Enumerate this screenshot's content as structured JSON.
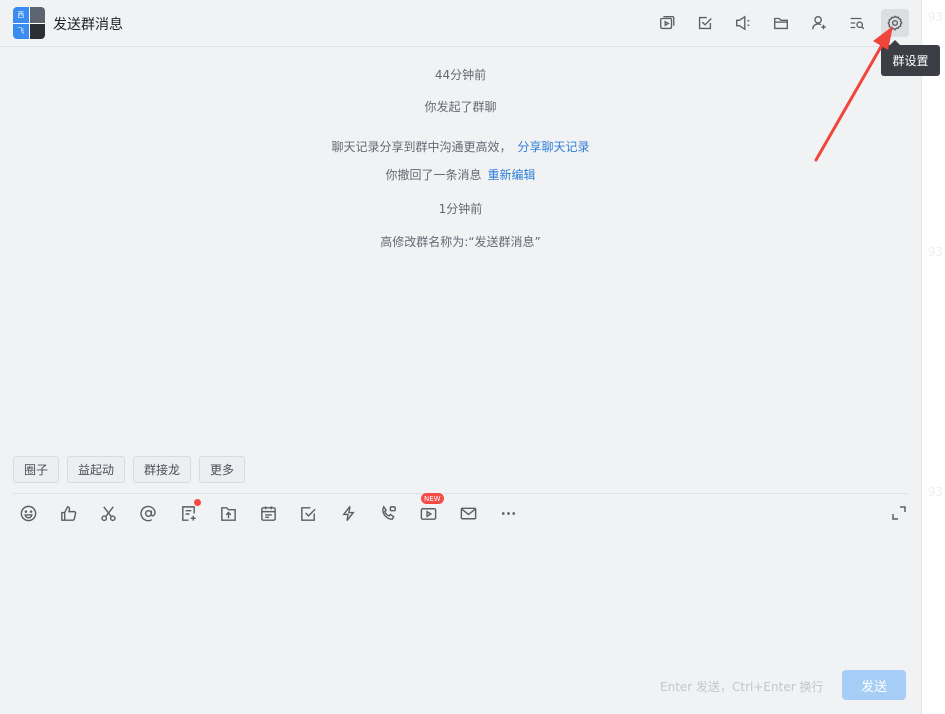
{
  "header": {
    "title": "发送群消息",
    "avatar_chars": [
      "西",
      "",
      "飞",
      ""
    ],
    "icons": [
      "video-window-icon",
      "todo-check-icon",
      "announcement-icon",
      "folder-icon",
      "add-member-icon",
      "search-history-icon",
      "settings-gear-icon"
    ],
    "tooltip": "群设置"
  },
  "messages": {
    "time1": "44分钟前",
    "started": "你发起了群聊",
    "share_text": "聊天记录分享到群中沟通更高效，",
    "share_link": "分享聊天记录",
    "recall_text": "你撤回了一条消息",
    "recall_link": "重新编辑",
    "time2": "1分钟前",
    "rename": "高修改群名称为:“发送群消息”"
  },
  "chips": [
    "圈子",
    "益起动",
    "群接龙",
    "更多"
  ],
  "toolbar": {
    "icons": [
      "emoji-icon",
      "thumbs-up-icon",
      "scissors-icon",
      "at-icon",
      "doc-add-icon",
      "upload-folder-icon",
      "calendar-icon",
      "task-check-icon",
      "lightning-icon",
      "phone-call-icon",
      "live-video-icon",
      "mail-icon",
      "more-icon"
    ],
    "new_badge": "NEW"
  },
  "input": {
    "hint": "Enter 发送，Ctrl+Enter 换行",
    "send_label": "发送"
  },
  "colors": {
    "accent": "#2f7fd9",
    "send_disabled": "#a6cdf5",
    "annotation_arrow": "#f0443c"
  }
}
